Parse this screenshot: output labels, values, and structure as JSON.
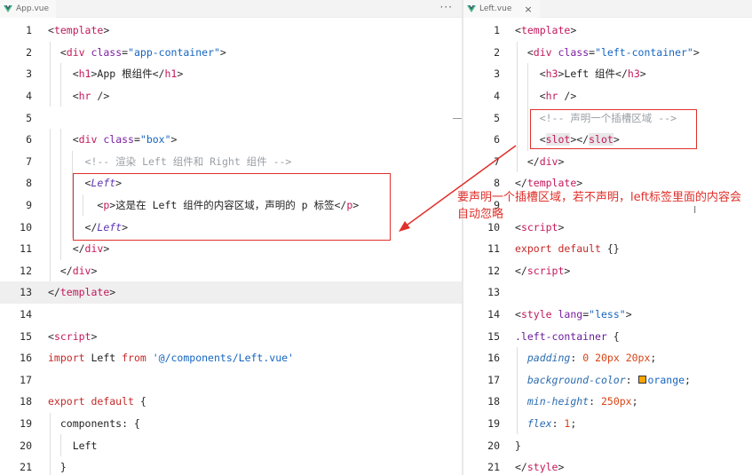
{
  "left_pane": {
    "tab": {
      "label": "App.vue",
      "icon": "vue-logo-icon",
      "more_icon": "ellipsis-icon"
    },
    "lines": [
      {
        "n": "1",
        "parts": [
          [
            "c-punc",
            "<"
          ],
          [
            "c-tag",
            "template"
          ],
          [
            "c-punc",
            ">"
          ]
        ]
      },
      {
        "n": "2",
        "parts": [
          [
            "c-punc",
            "  <"
          ],
          [
            "c-tag",
            "div"
          ],
          [
            "c-punc",
            " "
          ],
          [
            "c-attr",
            "class"
          ],
          [
            "c-punc",
            "="
          ],
          [
            "c-str",
            "\"app-container\""
          ],
          [
            "c-punc",
            ">"
          ]
        ]
      },
      {
        "n": "3",
        "parts": [
          [
            "c-punc",
            "    <"
          ],
          [
            "c-tag",
            "h1"
          ],
          [
            "c-punc",
            ">"
          ],
          [
            "c-text",
            "App 根组件"
          ],
          [
            "c-punc",
            "</"
          ],
          [
            "c-tag",
            "h1"
          ],
          [
            "c-punc",
            ">"
          ]
        ]
      },
      {
        "n": "4",
        "parts": [
          [
            "c-punc",
            "    <"
          ],
          [
            "c-tag",
            "hr"
          ],
          [
            "c-punc",
            " />"
          ]
        ]
      },
      {
        "n": "5",
        "parts": []
      },
      {
        "n": "6",
        "parts": [
          [
            "c-punc",
            "    <"
          ],
          [
            "c-tag",
            "div"
          ],
          [
            "c-punc",
            " "
          ],
          [
            "c-attr",
            "class"
          ],
          [
            "c-punc",
            "="
          ],
          [
            "c-str",
            "\"box\""
          ],
          [
            "c-punc",
            ">"
          ]
        ]
      },
      {
        "n": "7",
        "parts": [
          [
            "c-cmt",
            "      <!-- 渲染 Left 组件和 Right 组件 -->"
          ]
        ]
      },
      {
        "n": "8",
        "parts": [
          [
            "c-punc",
            "      <"
          ],
          [
            "c-ital",
            "Left"
          ],
          [
            "c-punc",
            ">"
          ]
        ]
      },
      {
        "n": "9",
        "parts": [
          [
            "c-punc",
            "        <"
          ],
          [
            "c-tag",
            "p"
          ],
          [
            "c-punc",
            ">"
          ],
          [
            "c-text",
            "这是在 Left 组件的内容区域，声明的 p 标签"
          ],
          [
            "c-punc",
            "</"
          ],
          [
            "c-tag",
            "p"
          ],
          [
            "c-punc",
            ">"
          ]
        ]
      },
      {
        "n": "10",
        "parts": [
          [
            "c-punc",
            "      </"
          ],
          [
            "c-ital",
            "Left"
          ],
          [
            "c-punc",
            ">"
          ]
        ]
      },
      {
        "n": "11",
        "parts": [
          [
            "c-punc",
            "    </"
          ],
          [
            "c-tag",
            "div"
          ],
          [
            "c-punc",
            ">"
          ]
        ]
      },
      {
        "n": "12",
        "parts": [
          [
            "c-punc",
            "  </"
          ],
          [
            "c-tag",
            "div"
          ],
          [
            "c-punc",
            ">"
          ]
        ]
      },
      {
        "n": "13",
        "parts": [
          [
            "c-punc",
            "</"
          ],
          [
            "c-tag",
            "template"
          ],
          [
            "c-punc",
            ">"
          ]
        ],
        "current": true
      },
      {
        "n": "14",
        "parts": []
      },
      {
        "n": "15",
        "parts": [
          [
            "c-punc",
            "<"
          ],
          [
            "c-tag",
            "script"
          ],
          [
            "c-punc",
            ">"
          ]
        ]
      },
      {
        "n": "16",
        "parts": [
          [
            "c-kw",
            "import"
          ],
          [
            "c-text",
            " Left "
          ],
          [
            "c-kw",
            "from"
          ],
          [
            "c-punc",
            " "
          ],
          [
            "c-str",
            "'@/components/Left.vue'"
          ]
        ]
      },
      {
        "n": "17",
        "parts": []
      },
      {
        "n": "18",
        "parts": [
          [
            "c-kw",
            "export default"
          ],
          [
            "c-punc",
            " {"
          ]
        ]
      },
      {
        "n": "19",
        "parts": [
          [
            "c-text",
            "  components: {"
          ]
        ]
      },
      {
        "n": "20",
        "parts": [
          [
            "c-text",
            "    Left"
          ]
        ]
      },
      {
        "n": "21",
        "parts": [
          [
            "c-text",
            "  }"
          ]
        ]
      }
    ]
  },
  "right_pane": {
    "tab": {
      "label": "Left.vue",
      "icon": "vue-logo-icon",
      "close": "×",
      "close_icon": "close-icon"
    },
    "lines": [
      {
        "n": "1",
        "parts": [
          [
            "c-punc",
            "<"
          ],
          [
            "c-tag",
            "template"
          ],
          [
            "c-punc",
            ">"
          ]
        ]
      },
      {
        "n": "2",
        "parts": [
          [
            "c-punc",
            "  <"
          ],
          [
            "c-tag",
            "div"
          ],
          [
            "c-punc",
            " "
          ],
          [
            "c-attr",
            "class"
          ],
          [
            "c-punc",
            "="
          ],
          [
            "c-str",
            "\"left-container\""
          ],
          [
            "c-punc",
            ">"
          ]
        ]
      },
      {
        "n": "3",
        "parts": [
          [
            "c-punc",
            "    <"
          ],
          [
            "c-tag",
            "h3"
          ],
          [
            "c-punc",
            ">"
          ],
          [
            "c-text",
            "Left 组件"
          ],
          [
            "c-punc",
            "</"
          ],
          [
            "c-tag",
            "h3"
          ],
          [
            "c-punc",
            ">"
          ]
        ]
      },
      {
        "n": "4",
        "parts": [
          [
            "c-punc",
            "    <"
          ],
          [
            "c-tag",
            "hr"
          ],
          [
            "c-punc",
            " />"
          ]
        ]
      },
      {
        "n": "5",
        "parts": [
          [
            "c-cmt",
            "    <!-- 声明一个插槽区域 -->"
          ]
        ]
      },
      {
        "n": "6",
        "parts": [
          [
            "c-punc",
            "    <"
          ],
          [
            "c-tag slot-bg",
            "slot"
          ],
          [
            "c-punc",
            "></"
          ],
          [
            "c-tag slot-bg",
            "slot"
          ],
          [
            "c-punc",
            ">"
          ]
        ]
      },
      {
        "n": "7",
        "parts": [
          [
            "c-punc",
            "  </"
          ],
          [
            "c-tag",
            "div"
          ],
          [
            "c-punc",
            ">"
          ]
        ]
      },
      {
        "n": "8",
        "parts": [
          [
            "c-punc",
            "</"
          ],
          [
            "c-tag",
            "template"
          ],
          [
            "c-punc",
            ">"
          ]
        ]
      },
      {
        "n": "9",
        "parts": []
      },
      {
        "n": "10",
        "parts": [
          [
            "c-punc",
            "<"
          ],
          [
            "c-tag",
            "script"
          ],
          [
            "c-punc",
            ">"
          ]
        ]
      },
      {
        "n": "11",
        "parts": [
          [
            "c-kw",
            "export default"
          ],
          [
            "c-punc",
            " {}"
          ]
        ]
      },
      {
        "n": "12",
        "parts": [
          [
            "c-punc",
            "</"
          ],
          [
            "c-tag",
            "script"
          ],
          [
            "c-punc",
            ">"
          ]
        ]
      },
      {
        "n": "13",
        "parts": []
      },
      {
        "n": "14",
        "parts": [
          [
            "c-punc",
            "<"
          ],
          [
            "c-tag",
            "style"
          ],
          [
            "c-punc",
            " "
          ],
          [
            "c-attr",
            "lang"
          ],
          [
            "c-punc",
            "="
          ],
          [
            "c-str",
            "\"less\""
          ],
          [
            "c-punc",
            ">"
          ]
        ]
      },
      {
        "n": "15",
        "parts": [
          [
            "c-sel",
            ".left-container"
          ],
          [
            "c-punc",
            " {"
          ]
        ]
      },
      {
        "n": "16",
        "parts": [
          [
            "c-punc",
            "  "
          ],
          [
            "c-prop",
            "padding"
          ],
          [
            "c-punc",
            ": "
          ],
          [
            "c-num",
            "0"
          ],
          [
            "c-punc",
            " "
          ],
          [
            "c-num",
            "20px"
          ],
          [
            "c-punc",
            " "
          ],
          [
            "c-num",
            "20px"
          ],
          [
            "c-punc",
            ";"
          ]
        ]
      },
      {
        "n": "17",
        "parts": [
          [
            "c-punc",
            "  "
          ],
          [
            "c-prop",
            "background-color"
          ],
          [
            "c-punc",
            ": "
          ],
          [
            "swatch",
            ""
          ],
          [
            "c-str",
            "orange"
          ],
          [
            "c-punc",
            ";"
          ]
        ]
      },
      {
        "n": "18",
        "parts": [
          [
            "c-punc",
            "  "
          ],
          [
            "c-prop",
            "min-height"
          ],
          [
            "c-punc",
            ": "
          ],
          [
            "c-num",
            "250px"
          ],
          [
            "c-punc",
            ";"
          ]
        ]
      },
      {
        "n": "19",
        "parts": [
          [
            "c-punc",
            "  "
          ],
          [
            "c-prop",
            "flex"
          ],
          [
            "c-punc",
            ": "
          ],
          [
            "c-num",
            "1"
          ],
          [
            "c-punc",
            ";"
          ]
        ]
      },
      {
        "n": "20",
        "parts": [
          [
            "c-punc",
            "}"
          ]
        ]
      },
      {
        "n": "21",
        "parts": [
          [
            "c-punc",
            "</"
          ],
          [
            "c-tag",
            "style"
          ],
          [
            "c-punc",
            ">"
          ]
        ]
      }
    ]
  },
  "annotation": {
    "text": "要声明一个插槽区域，若不声明，left标签里面的内容会自动忽略",
    "color": "#e0302a",
    "cursor_icon": "text-cursor-icon"
  }
}
